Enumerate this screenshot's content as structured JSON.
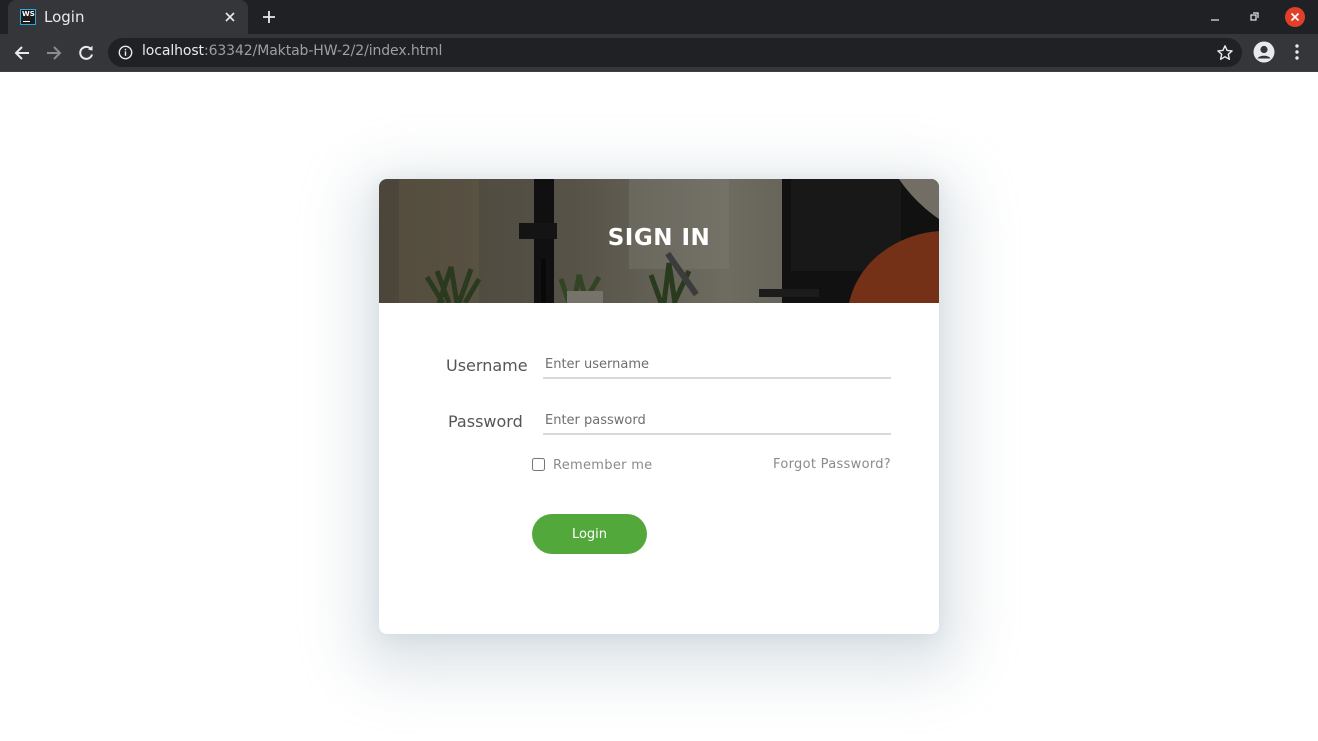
{
  "browser": {
    "tab_title": "Login",
    "favicon_text": "WS",
    "url_host": "localhost",
    "url_rest": ":63342/Maktab-HW-2/2/index.html"
  },
  "login": {
    "title": "SIGN IN",
    "username_label": "Username",
    "username_placeholder": "Enter username",
    "password_label": "Password",
    "password_placeholder": "Enter password",
    "remember_label": "Remember me",
    "forgot_label": "Forgot Password?",
    "button_label": "Login",
    "accent_color": "#52a83a"
  },
  "icons": [
    "ws-favicon-icon",
    "close-icon",
    "plus-icon",
    "minimize-icon",
    "restore-icon",
    "window-close-icon",
    "back-arrow-icon",
    "forward-arrow-icon",
    "reload-icon",
    "info-icon",
    "star-icon",
    "profile-icon",
    "kebab-menu-icon"
  ]
}
